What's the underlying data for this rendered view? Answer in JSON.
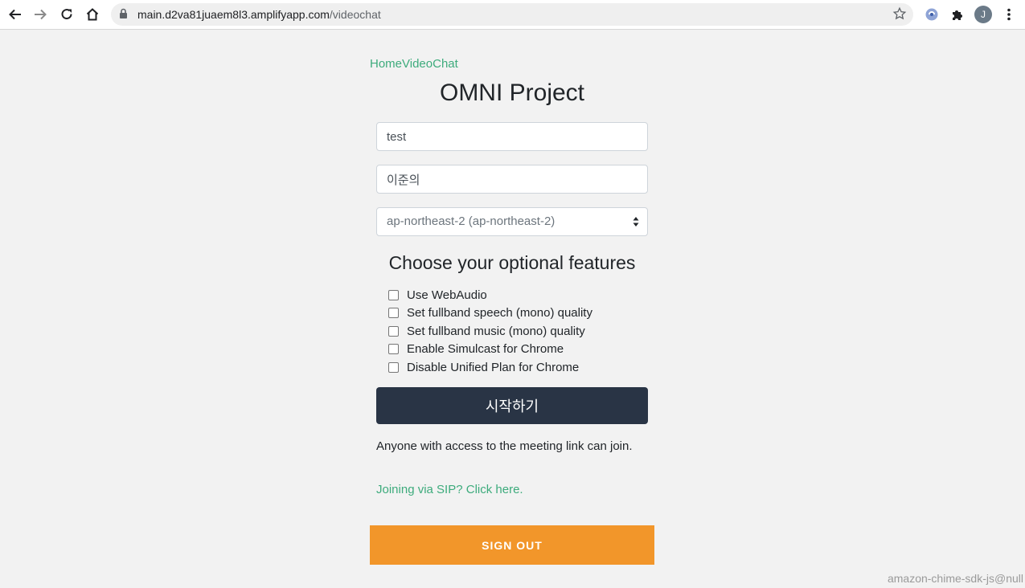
{
  "browser": {
    "url_domain": "main.d2va81juaem8l3.amplifyapp.com",
    "url_path": "/videochat",
    "avatar_letter": "J",
    "icons": [
      "back-icon",
      "forward-icon",
      "reload-icon",
      "home-icon",
      "lock-icon",
      "star-icon",
      "extension-icon",
      "puzzle-icon",
      "avatar",
      "more-icon"
    ]
  },
  "nav": {
    "home": "Home",
    "videochat": "VideoChat"
  },
  "page": {
    "title": "OMNI Project",
    "meeting_input": {
      "value": "test",
      "placeholder": ""
    },
    "name_input": {
      "value": "이준의",
      "placeholder": ""
    },
    "region_select": {
      "selected": "ap-northeast-2 (ap-northeast-2)"
    },
    "features_heading": "Choose your optional features",
    "features": [
      {
        "label": "Use WebAudio",
        "checked": false
      },
      {
        "label": "Set fullband speech (mono) quality",
        "checked": false
      },
      {
        "label": "Set fullband music (mono) quality",
        "checked": false
      },
      {
        "label": "Enable Simulcast for Chrome",
        "checked": false
      },
      {
        "label": "Disable Unified Plan for Chrome",
        "checked": false
      }
    ],
    "start_button": "시작하기",
    "notice": "Anyone with access to the meeting link can join.",
    "sip_link": "Joining via SIP? Click here.",
    "signout_button": "SIGN OUT",
    "footer_note": "amazon-chime-sdk-js@null"
  },
  "colors": {
    "link": "#3dab7c",
    "start_button": "#293445",
    "signout_button": "#f2962a"
  }
}
